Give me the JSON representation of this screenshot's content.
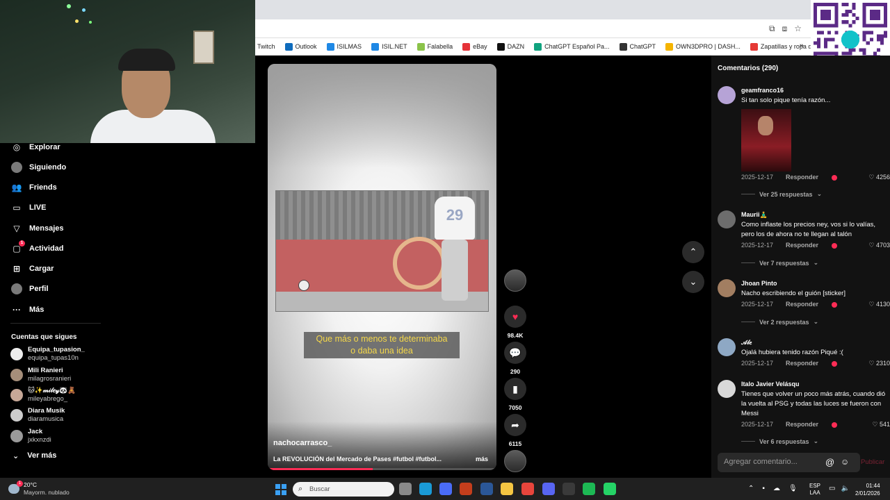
{
  "bookmarks": [
    {
      "label": "Twitch",
      "color": ""
    },
    {
      "label": "Outlook",
      "color": "#0f6cbd"
    },
    {
      "label": "ISILMAS",
      "color": "#1e88e5"
    },
    {
      "label": "ISIL.NET",
      "color": "#1e88e5"
    },
    {
      "label": "Falabella",
      "color": "#8bc34a"
    },
    {
      "label": "eBay",
      "color": "#e53238"
    },
    {
      "label": "DAZN",
      "color": "#111111"
    },
    {
      "label": "ChatGPT Español Pa...",
      "color": "#10a37f"
    },
    {
      "label": "ChatGPT",
      "color": "#333333"
    },
    {
      "label": "OWN3DPRO | DASH...",
      "color": "#f5b400"
    },
    {
      "label": "Zapatillas y ropa de...",
      "color": "#e53935"
    }
  ],
  "bookmarks_more": "»",
  "sidebar": {
    "nav": [
      {
        "label": "Explorar",
        "icon": "compass-icon",
        "glyph": "◎"
      },
      {
        "label": "Siguiendo",
        "icon": "following-avatar-icon",
        "glyph": "●"
      },
      {
        "label": "Friends",
        "icon": "friends-icon",
        "glyph": "👥"
      },
      {
        "label": "LIVE",
        "icon": "live-tv-icon",
        "glyph": "▭"
      },
      {
        "label": "Mensajes",
        "icon": "send-icon",
        "glyph": "▽"
      },
      {
        "label": "Actividad",
        "icon": "activity-icon",
        "glyph": "▢",
        "badge": "1"
      },
      {
        "label": "Cargar",
        "icon": "upload-plus-icon",
        "glyph": "⊞"
      },
      {
        "label": "Perfil",
        "icon": "profile-avatar-icon",
        "glyph": "●"
      },
      {
        "label": "Más",
        "icon": "more-dots-icon",
        "glyph": "···"
      }
    ],
    "following_header": "Cuentas que sigues",
    "following": [
      {
        "name": "Equipa_tupasion_",
        "user": "equipa_tupas10n",
        "color": "#eeeeee"
      },
      {
        "name": "Mili Ranieri",
        "user": "milagrosranieri",
        "color": "#a58e7a"
      },
      {
        "name": "🐱✨𝓂𝒾𝓁𝑒𝓎🐼🧸",
        "user": "mileyabrego_",
        "color": "#c7a898"
      },
      {
        "name": "Diara Musik",
        "user": "diaramusica",
        "color": "#cccccc"
      },
      {
        "name": "Jack",
        "user": "jxkxnzdi",
        "color": "#9a9a9a"
      }
    ],
    "see_more": "Ver más"
  },
  "video": {
    "subtitle_line1": "Que más o menos te determinaba",
    "subtitle_line2": "o daba una idea",
    "jersey_number": "29",
    "author": "nachocarrasco_",
    "description": "La REVOLUCIÓN del Mercado de Pases #futbol #futbol...",
    "more": "más",
    "progress": 0.46
  },
  "actions": {
    "likes": "98.4K",
    "comments": "290",
    "saves": "7050",
    "shares": "6115"
  },
  "comments_panel": {
    "header": "Comentarios (290)",
    "input_placeholder": "Agregar comentario...",
    "post_label": "Publicar",
    "reply_label": "Responder",
    "items": [
      {
        "user": "geamfranco16",
        "text": "Si tan solo pique tenía razón...",
        "date": "2025-12-17",
        "likes": "4256",
        "replies": "Ver 25 respuestas",
        "avatar_color": "#b6a3d6",
        "has_image": true
      },
      {
        "user": "Maurii🧘‍♂️",
        "text": "Como inflaste los precios ney, vos si lo valías, pero los de ahora no te llegan al talón",
        "date": "2025-12-17",
        "likes": "4703",
        "replies": "Ver 7 respuestas",
        "avatar_color": "#6d6d6d",
        "has_image": false
      },
      {
        "user": "Jhoan Pinto",
        "text": "Nacho escribiendo el guión [sticker]",
        "date": "2025-12-17",
        "likes": "4130",
        "replies": "Ver 2 respuestas",
        "avatar_color": "#a27e61",
        "has_image": false
      },
      {
        "user": "𝒜𝓁𝑒",
        "text": "Ojalá hubiera tenido razón Piqué :(",
        "date": "2025-12-17",
        "likes": "2310",
        "replies": "",
        "avatar_color": "#8ea8c4",
        "has_image": false
      },
      {
        "user": "Italo Javier Velásqu",
        "text": "Tienes que volver un poco más atrás, cuando dió la vuelta al PSG y todas las luces se fueron con Messi",
        "date": "2025-12-17",
        "likes": "541",
        "replies": "Ver 6 respuestas",
        "avatar_color": "#d8d8d8",
        "has_image": false
      }
    ]
  },
  "taskbar": {
    "weather_temp": "20°C",
    "weather_desc": "Mayorm. nublado",
    "weather_badge": "1",
    "search_placeholder": "Buscar",
    "lang_line1": "ESP",
    "lang_line2": "LAA",
    "time": "01:44",
    "date": "2/01/2026",
    "apps": [
      {
        "name": "file-explorer-icon",
        "color": "#8a8a8a"
      },
      {
        "name": "edge-icon",
        "color": "#1a9ad6"
      },
      {
        "name": "store-icon",
        "color": "#4a6cf7"
      },
      {
        "name": "powerpoint-icon",
        "color": "#c43e1c"
      },
      {
        "name": "word-icon",
        "color": "#2b5797"
      },
      {
        "name": "folder-icon",
        "color": "#f4c542"
      },
      {
        "name": "chrome-icon",
        "color": "#e8453c"
      },
      {
        "name": "discord-icon",
        "color": "#5865f2"
      },
      {
        "name": "obs-icon",
        "color": "#3a3a3a"
      },
      {
        "name": "spotify-icon",
        "color": "#1db954"
      },
      {
        "name": "whatsapp-icon",
        "color": "#25d366"
      }
    ]
  }
}
